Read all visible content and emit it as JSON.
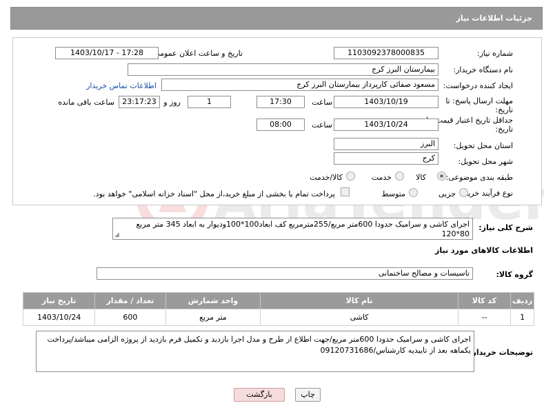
{
  "header": {
    "title": "جزئیات اطلاعات نیاز"
  },
  "form": {
    "need_number_label": "شماره نیاز:",
    "need_number": "1103092378000835",
    "announce_label": "تاریخ و ساعت اعلان عمومی:",
    "announce_value": "1403/10/17 - 17:28",
    "buyer_org_label": "نام دستگاه خریدار:",
    "buyer_org": "بیمارستان البرز کرج",
    "creator_label": "ایجاد کننده درخواست:",
    "creator": "مسعود صفائی کارپرداز بیمارستان البرز کرج",
    "buyer_contact_link": "اطلاعات تماس خریدار",
    "deadline_label_1": "مهلت ارسال پاسخ: تا",
    "deadline_label_2": "تاریخ:",
    "deadline_date": "1403/10/19",
    "time_label": "ساعت",
    "deadline_time": "17:30",
    "days_count": "1",
    "days_and_label": "روز و",
    "remaining_time": "23:17:23",
    "remaining_label": "ساعت باقی مانده",
    "validity_label_1": "حداقل تاریخ اعتبار قیمت: تا",
    "validity_label_2": "تاریخ:",
    "validity_date": "1403/10/24",
    "validity_time": "08:00",
    "province_label": "استان محل تحویل:",
    "province": "البرز",
    "city_label": "شهر محل تحویل:",
    "city": "کرج",
    "category_label": "طبقه بندی موضوعی:",
    "category_options": [
      "کالا",
      "خدمت",
      "کالا/خدمت"
    ],
    "process_label": "نوع فرآیند خرید :",
    "process_options": [
      "جزیی",
      "متوسط"
    ],
    "payment_note": "پرداخت تمام یا بخشی از مبلغ خرید،از محل \"اسناد خزانه اسلامی\" خواهد بود."
  },
  "summary": {
    "label": "شرح کلی نیاز:",
    "text": "اجرای کاشی و سرامیک حدودا 600متر مربع/255مترمربع کف ابعاد100*100ودیوار به ابعاد 345 متر مربع 80*120"
  },
  "goods": {
    "section_title": "اطلاعات کالاهای مورد نیاز",
    "group_label": "گروه کالا:",
    "group_value": "تاسیسات و مصالح ساختمانی"
  },
  "table": {
    "headers": [
      "ردیف",
      "کد کالا",
      "نام کالا",
      "واحد شمارش",
      "تعداد / مقدار",
      "تاریخ نیاز"
    ],
    "rows": [
      [
        "1",
        "--",
        "کاشی",
        "متر مربع",
        "600",
        "1403/10/24"
      ]
    ]
  },
  "buyer_notes": {
    "label": "توضیحات خریدار:",
    "text": "اجرای کاشی و سرامیک حدودا 600متر مربع/جهت اطلاع از طرح و مدل اجرا بازدید و تکمیل فرم بازدید از پروژه الزامی میباشد/پرداخت یکماهه بعد از تاییدیه کارشناس/09120731686"
  },
  "buttons": {
    "print": "چاپ",
    "back": "بازگشت"
  },
  "colors": {
    "header_bg": "#999999",
    "link": "#1a4ea8",
    "back_button_bg": "#f6dcdc"
  }
}
